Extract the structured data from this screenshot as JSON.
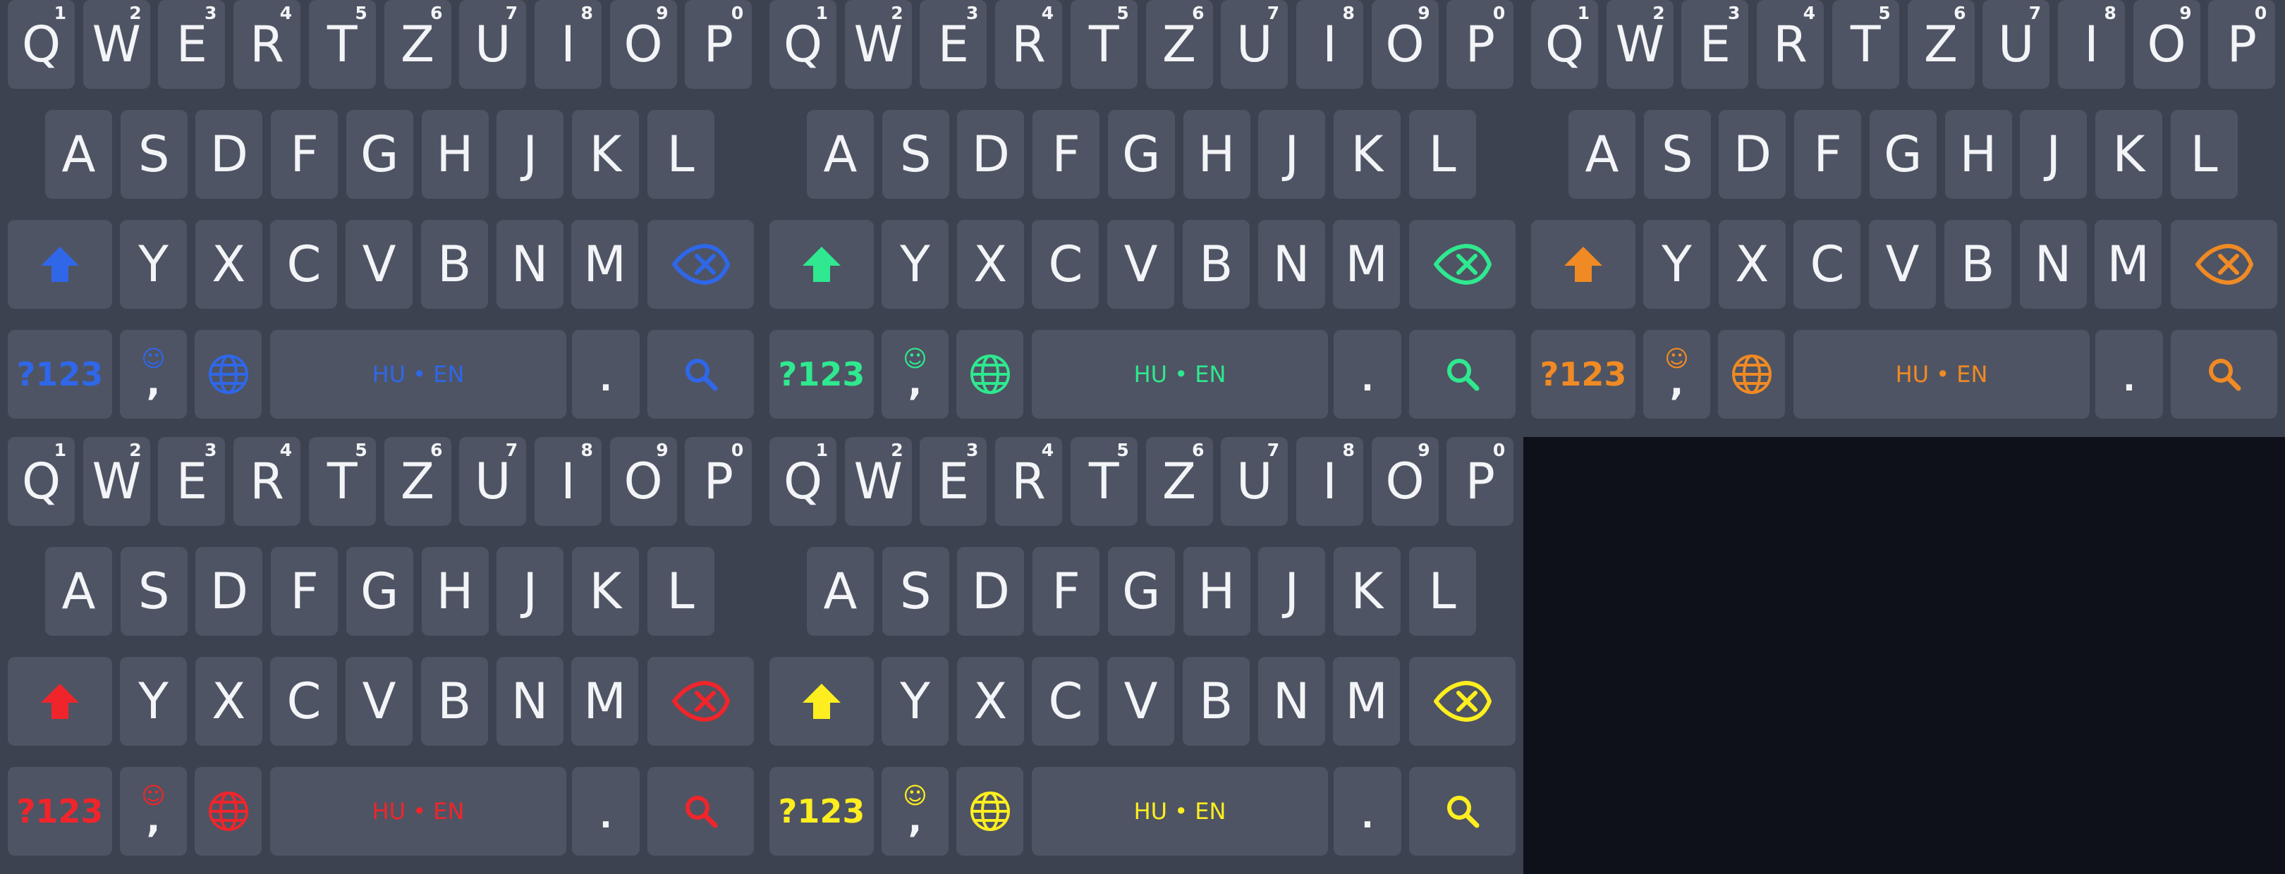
{
  "rows": {
    "top": [
      {
        "letter": "Q",
        "hint": "1"
      },
      {
        "letter": "W",
        "hint": "2"
      },
      {
        "letter": "E",
        "hint": "3"
      },
      {
        "letter": "R",
        "hint": "4"
      },
      {
        "letter": "T",
        "hint": "5"
      },
      {
        "letter": "Z",
        "hint": "6"
      },
      {
        "letter": "U",
        "hint": "7"
      },
      {
        "letter": "I",
        "hint": "8"
      },
      {
        "letter": "O",
        "hint": "9"
      },
      {
        "letter": "P",
        "hint": "0"
      }
    ],
    "home": [
      "A",
      "S",
      "D",
      "F",
      "G",
      "H",
      "J",
      "K",
      "L"
    ],
    "bottom": [
      "Y",
      "X",
      "C",
      "V",
      "B",
      "N",
      "M"
    ]
  },
  "bottom_bar": {
    "symbols_label": "?123",
    "emoji_label": "☺",
    "comma_label": ",",
    "space_label": "HU • EN",
    "period_label": "."
  },
  "icons": {
    "shift": "shift-arrow-icon",
    "backspace": "backspace-icon",
    "language": "globe-icon",
    "action": "search-icon"
  },
  "keyboards": [
    {
      "theme": "blue",
      "accent": "#2f67e8"
    },
    {
      "theme": "green",
      "accent": "#2fe88f"
    },
    {
      "theme": "orange",
      "accent": "#f08a24"
    },
    {
      "theme": "red",
      "accent": "#f0252b"
    },
    {
      "theme": "yellow",
      "accent": "#ffee1f"
    }
  ],
  "colors": {
    "screen_background": "#0e111a",
    "keyboard_background": "#3c4250",
    "key_background": "#4e5463",
    "key_text": "#f3f4f7"
  }
}
